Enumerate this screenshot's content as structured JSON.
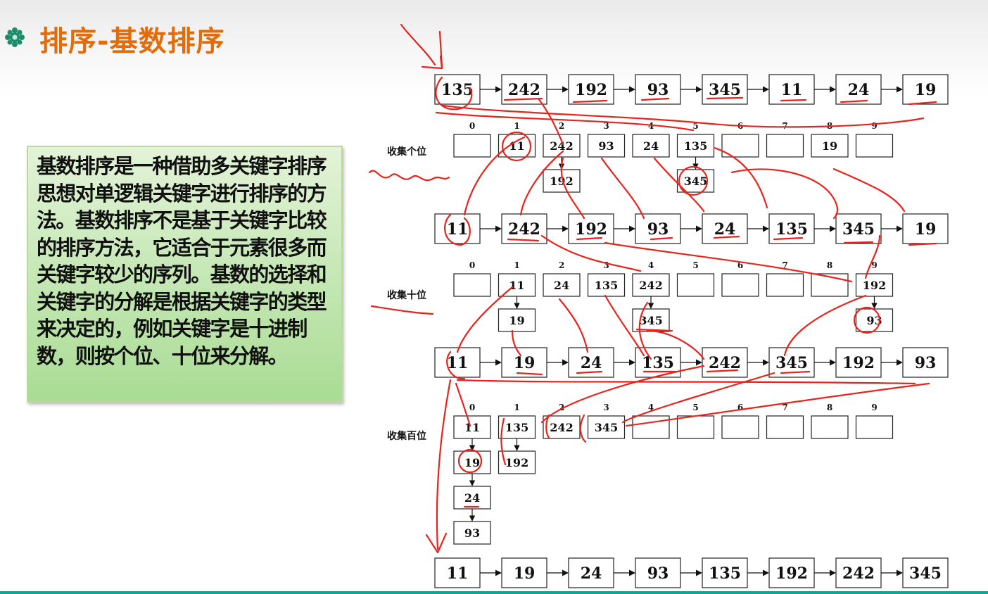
{
  "slide": {
    "title": "排序-基数排序",
    "description": "基数排序是一种借助多关键字排序思想对单逻辑关键字进行排序的方法。基数排序不是基于关键字比较的排序方法，它适合于元素很多而关键字较少的序列。基数的选择和关键字的分解是根据关键字的类型来决定的，例如关键字是十进制数，则按个位、十位来分解。",
    "bullet_icon": "gear-flower-icon",
    "title_color": "#e36c0a",
    "box_color": "#a9dc94",
    "annotation_color": "#e8231c"
  },
  "diagram": {
    "bucket_indices": [
      "0",
      "1",
      "2",
      "3",
      "4",
      "5",
      "6",
      "7",
      "8",
      "9"
    ],
    "sequences": [
      [
        "135",
        "242",
        "192",
        "93",
        "345",
        "11",
        "24",
        "19"
      ],
      [
        "11",
        "242",
        "192",
        "93",
        "24",
        "135",
        "345",
        "19"
      ],
      [
        "11",
        "19",
        "24",
        "135",
        "242",
        "345",
        "192",
        "93"
      ],
      [
        "11",
        "19",
        "24",
        "93",
        "135",
        "192",
        "242",
        "345"
      ]
    ],
    "stages": [
      {
        "label": "收集个位",
        "buckets": [
          [],
          [
            "11"
          ],
          [
            "242",
            "192"
          ],
          [
            "93"
          ],
          [
            "24"
          ],
          [
            "135",
            "345"
          ],
          [],
          [],
          [
            "19"
          ],
          []
        ]
      },
      {
        "label": "收集十位",
        "buckets": [
          [],
          [
            "11",
            "19"
          ],
          [
            "24"
          ],
          [
            "135"
          ],
          [
            "242",
            "345"
          ],
          [],
          [],
          [],
          [],
          [
            "192",
            "93"
          ]
        ]
      },
      {
        "label": "收集百位",
        "buckets": [
          [
            "11",
            "19",
            "24",
            "93"
          ],
          [
            "135",
            "192"
          ],
          [
            "242"
          ],
          [
            "345"
          ],
          [],
          [],
          [],
          [],
          [],
          []
        ]
      }
    ]
  }
}
